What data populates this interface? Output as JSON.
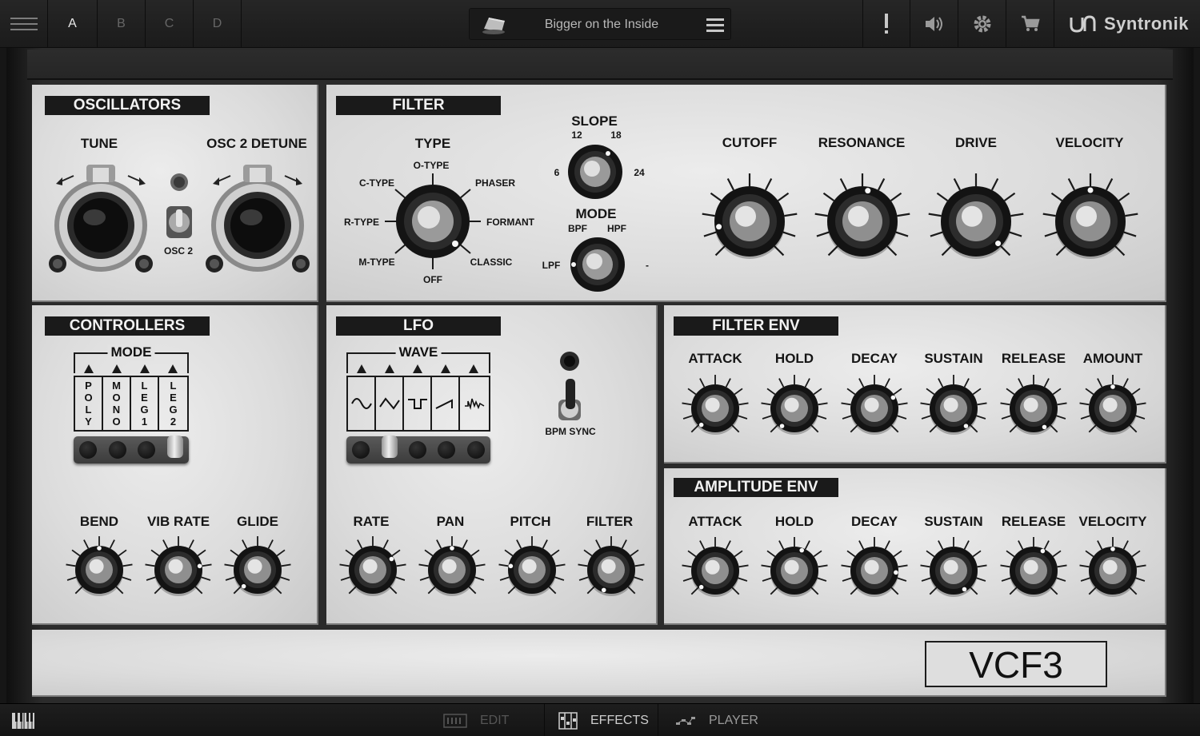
{
  "topbar": {
    "slots": [
      "A",
      "B",
      "C",
      "D"
    ],
    "active_slot": "A",
    "preset_name": "Bigger on the Inside",
    "brand": "Syntronik",
    "icons": [
      "hamburger-icon",
      "preset-file-icon",
      "menu-icon",
      "alert-icon",
      "speaker-icon",
      "gear-icon",
      "cart-icon",
      "syntronik-logo-icon"
    ]
  },
  "oscillators": {
    "title": "OSCILLATORS",
    "tune_label": "TUNE",
    "detune_label": "OSC 2 DETUNE",
    "osc2_label": "OSC 2"
  },
  "filter": {
    "title": "FILTER",
    "type_label": "TYPE",
    "type_options": [
      "C-TYPE",
      "O-TYPE",
      "PHASER",
      "R-TYPE",
      "FORMANT",
      "M-TYPE",
      "OFF",
      "CLASSIC"
    ],
    "slope_label": "SLOPE",
    "slope_values": [
      "6",
      "12",
      "18",
      "24"
    ],
    "mode_label": "MODE",
    "mode_options": [
      "LPF",
      "BPF",
      "HPF",
      "-"
    ],
    "knobs": [
      "CUTOFF",
      "RESONANCE",
      "DRIVE",
      "VELOCITY"
    ]
  },
  "controllers": {
    "title": "CONTROLLERS",
    "mode_label": "MODE",
    "mode_options": [
      "POLY",
      "MONO",
      "LEG1",
      "LEG2"
    ],
    "selected_mode": "LEG2",
    "knobs": [
      "BEND",
      "VIB RATE",
      "GLIDE"
    ]
  },
  "lfo": {
    "title": "LFO",
    "wave_label": "WAVE",
    "waves": [
      "sine",
      "triangle",
      "square",
      "saw",
      "random"
    ],
    "selected_wave": "triangle",
    "bpm_sync_label": "BPM SYNC",
    "knobs": [
      "RATE",
      "PAN",
      "PITCH",
      "FILTER"
    ]
  },
  "filter_env": {
    "title": "FILTER ENV",
    "knobs": [
      "ATTACK",
      "HOLD",
      "DECAY",
      "SUSTAIN",
      "RELEASE",
      "AMOUNT"
    ]
  },
  "amp_env": {
    "title": "AMPLITUDE ENV",
    "knobs": [
      "ATTACK",
      "HOLD",
      "DECAY",
      "SUSTAIN",
      "RELEASE",
      "VELOCITY"
    ]
  },
  "display": {
    "text": "VCF3"
  },
  "bottombar": {
    "tabs": [
      "EDIT",
      "EFFECTS",
      "PLAYER"
    ],
    "active_tab": "EFFECTS"
  }
}
